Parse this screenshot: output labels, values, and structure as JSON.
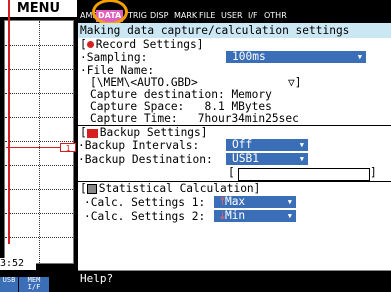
{
  "left": {
    "menu_label": "MENU",
    "time_label": "3:52",
    "usb_label": "USB",
    "mem_label": "MEM",
    "mem_sub": "I/F",
    "marker_label": "1"
  },
  "tabs": [
    {
      "label": "AMP",
      "active": false
    },
    {
      "label": "DATA",
      "active": true
    },
    {
      "label": "TRIG",
      "active": false
    },
    {
      "label": "DISP",
      "active": false
    },
    {
      "label": "MARK",
      "active": false
    },
    {
      "label": "FILE",
      "active": false
    },
    {
      "label": "USER",
      "active": false
    },
    {
      "label": "I/F",
      "active": false
    },
    {
      "label": "OTHR",
      "active": false
    }
  ],
  "main": {
    "title": "Making data capture/calculation settings",
    "record": {
      "header": "Record Settings]",
      "sampling_label": "·Sampling:",
      "sampling_value": "100ms",
      "file_name_label": "·File Name:",
      "file_name_value": "[\\MEM\\<AUTO.GBD>",
      "file_name_arrow": "▽]",
      "capture_dest": "Capture destination: Memory",
      "capture_space": "Capture Space:   8.1 MBytes",
      "capture_time": "Capture Time:   7hour34min25sec"
    },
    "backup": {
      "header": "Backup Settings]",
      "intervals_label": "·Backup Intervals:",
      "intervals_value": "Off",
      "destination_label": "·Backup Destination:",
      "destination_value": "USB1",
      "path_open": "[",
      "path_close": "]"
    },
    "stat": {
      "header": "Statistical Calculation]",
      "calc1_label": "·Calc. Settings 1:",
      "calc1_value": "Max",
      "calc2_label": "·Calc. Settings 2:",
      "calc2_value": "Min"
    }
  },
  "help": "Help?",
  "colors": {
    "accent": "#3a6fb8",
    "active_tab": "#e25fbd",
    "title_bar": "#cce7f4",
    "highlight_ring": "#f5a000",
    "record_red": "#d62020"
  }
}
